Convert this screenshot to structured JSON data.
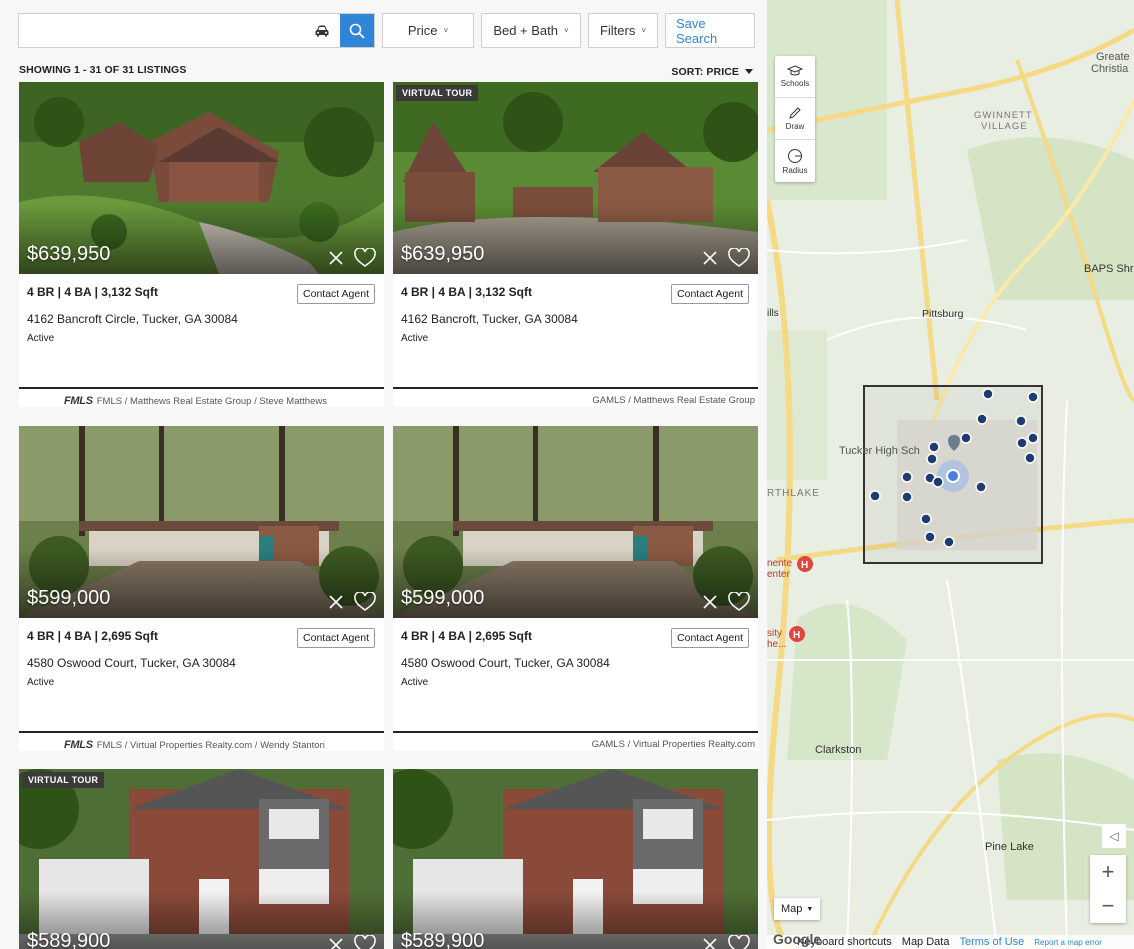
{
  "search": {
    "placeholder": "",
    "value": ""
  },
  "filters": {
    "price": "Price",
    "bed_bath": "Bed + Bath",
    "filters": "Filters",
    "save": "Save Search"
  },
  "results": {
    "showing": "SHOWING 1 - 31 OF 31 LISTINGS",
    "sort": "SORT: PRICE"
  },
  "listings": [
    {
      "price": "$639,950",
      "specs": "4 BR | 4 BA | 3,132 Sqft",
      "address": "4162 Bancroft Circle, Tucker, GA 30084",
      "status": "Active",
      "contact": "Contact Agent",
      "badge": "",
      "source_logo": "FMLS",
      "source": "FMLS / Matthews Real Estate Group / Steve Matthews"
    },
    {
      "price": "$639,950",
      "specs": "4 BR | 4 BA | 3,132 Sqft",
      "address": "4162 Bancroft, Tucker, GA 30084",
      "status": "Active",
      "contact": "Contact Agent",
      "badge": "VIRTUAL TOUR",
      "source_logo": "",
      "source": "GAMLS / Matthews Real Estate Group"
    },
    {
      "price": "$599,000",
      "specs": "4 BR | 4 BA | 2,695 Sqft",
      "address": "4580 Oswood Court, Tucker, GA 30084",
      "status": "Active",
      "contact": "Contact Agent",
      "badge": "",
      "source_logo": "FMLS",
      "source": "FMLS / Virtual Properties Realty.com / Wendy Stanton"
    },
    {
      "price": "$599,000",
      "specs": "4 BR | 4 BA | 2,695 Sqft",
      "address": "4580 Oswood Court, Tucker, GA 30084",
      "status": "Active",
      "contact": "Contact Agent",
      "badge": "",
      "source_logo": "",
      "source": "GAMLS / Virtual Properties Realty.com"
    },
    {
      "price": "$589,900",
      "badge": "VIRTUAL TOUR"
    },
    {
      "price": "$589,900",
      "badge": ""
    }
  ],
  "map": {
    "tools": [
      "Schools",
      "Draw",
      "Radius"
    ],
    "type": "Map",
    "zoom_in": "+",
    "zoom_out": "−",
    "labels": {
      "gwinnett": "GWINNETT",
      "village": "VILLAGE",
      "pittsburg": "Pittsburg",
      "tucker_high": "Tucker High Sch",
      "northlake": "RTHLAKE",
      "clarkston": "Clarkston",
      "pine_lake": "Pine Lake",
      "baps": "BAPS Shr",
      "greater": "Greate",
      "christian": "Christia",
      "hills": "ills",
      "center": "nente",
      "center2": "enter",
      "city": "sity",
      "city2": "he..."
    },
    "attribution": {
      "keyboard": "Keyboard shortcuts",
      "mapdata": "Map Data",
      "terms": "Terms of Use",
      "report": "Report a map error",
      "google": "Google"
    },
    "colors": {
      "pin": "#1f3b73",
      "selection_border": "#333333",
      "road": "#f5d985"
    }
  }
}
